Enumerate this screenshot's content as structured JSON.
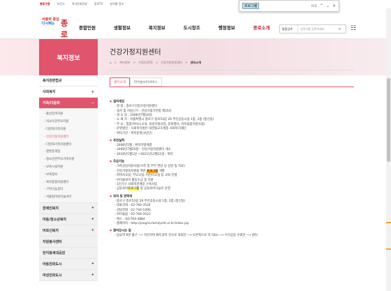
{
  "topbar": {
    "links": [
      "종로구청",
      "보건소",
      "역사문화관광",
      "종로TV",
      "분야별 정보"
    ]
  },
  "findbar": {
    "query": "프로그램",
    "count": "0/2",
    "prev": "⌃",
    "next": "⌄",
    "close": "×"
  },
  "header": {
    "logo_line1": "서울의 중심",
    "logo_line2": "다시뛰는",
    "logo_name": "종로",
    "nav": [
      "종합민원",
      "생활정보",
      "복지정보",
      "도시창조",
      "행정정보",
      "종로소개"
    ],
    "search_select": "통합검색",
    "search_placeholder": "검색어를 입력하세요"
  },
  "sidebar": {
    "title": "복지정보",
    "items": [
      {
        "label": "복지관련법규",
        "mark": "",
        "state": "normal"
      },
      {
        "label": "사회복지",
        "mark": "+",
        "state": "normal"
      },
      {
        "label": "가족/다문화",
        "mark": "−",
        "state": "on"
      }
    ],
    "subitems": [
      "출산장려지원",
      "저소득한부모지원",
      "다문화가족지원",
      "건강가정지원센터",
      "다문화가족지원센터",
      "결혼중개업",
      "청소년한부모가족지원",
      "보육시설지원",
      "보육정보",
      "육아종합지원센터",
      "구민나눔장터",
      "서울형어린이놀이터"
    ],
    "active_sub": "건강가정지원센터",
    "items2": [
      {
        "label": "장애인복지",
        "mark": "+"
      },
      {
        "label": "아동/청소년복지",
        "mark": "+"
      },
      {
        "label": "어르신복지",
        "mark": "+"
      },
      {
        "label": "자원봉사센터",
        "mark": ""
      },
      {
        "label": "한지붕세대공감",
        "mark": ""
      },
      {
        "label": "아동친화도시",
        "mark": "+"
      },
      {
        "label": "여성친화도시",
        "mark": "+"
      }
    ]
  },
  "content": {
    "title": "건강가정지원센터",
    "breadcrumb": [
      "⌂",
      "복지정보",
      "가족/다문화",
      "건강가정지원센터",
      "센터소개"
    ],
    "tabs": [
      "센터소개",
      "아이돌보미서비스"
    ],
    "sections": [
      {
        "head": "설치개요",
        "lines": [
          "명 칭 : 종로구건강가정지원센터",
          "설치 및 지원근거 : 건강가정기본법 제35조",
          "개 소 일 : 2006년7월20일",
          "소 재 지 : 서울특별시 종로구 종로53길 29 주민공동시설 1층, 2층 (창신동)",
          "주      요 : 통합서비스(교육, 육성지원사업, 문화행사, 아이돌봄지원사업)",
          "운영법인 : 사회복지법인 대한불교조계종 사회복지재단",
          "위탁기간 : 위탁운영(3년간)"
        ]
      },
      {
        "head": "추진실적",
        "lines": [
          "2006년5월 : 위탁약정체결",
          "2006년7월20일 : 건강가정지원센터 개소",
          "2019년1월1일 ~2021년12월31일 : 위탁"
        ]
      },
      {
        "head": "주요기능",
        "lines": [
          "가족상담지원사업(가족 및 부부 면담 등 상담 및 치료)",
          "건강가정육지원을 위한 [프로그램] 개발",
          "아버지교실, 부모교실, 어린이교실 등 교육 진행",
          "아이돌보미 활동수급 및 지원",
          "1인가구 사회적관계망 구축사업",
          "공동육아[프로그램] 및 공동육아나눔터 운영"
        ]
      },
      {
        "head": "위치 및 연락처",
        "lines": [
          "종로구 종로53길 29 주민공동시설 1층, 2층 (창신동)",
          "대표전화 : 02-764-3524",
          "상담전화 : 02-744-1090",
          "아이돌봄 : 02-764-3523",
          "팩스 : 02)764-4884",
          "홈페이지 : http://jongno.familynet.or.kr/index.jsp"
        ]
      },
      {
        "head": "찾아오시는 길",
        "lines": [
          "동묘역 6번 출구 ⟶ 직진하여 BYC골목 안으로 좌회전 ⟶ 오른쪽으로 약 50m ⟶ 우리공동 우회전 ⟶ 센터"
        ]
      }
    ]
  },
  "colors": {
    "accent": "#e0546c",
    "highlight": "#fff44f",
    "highlight_current": "#f6a623"
  }
}
